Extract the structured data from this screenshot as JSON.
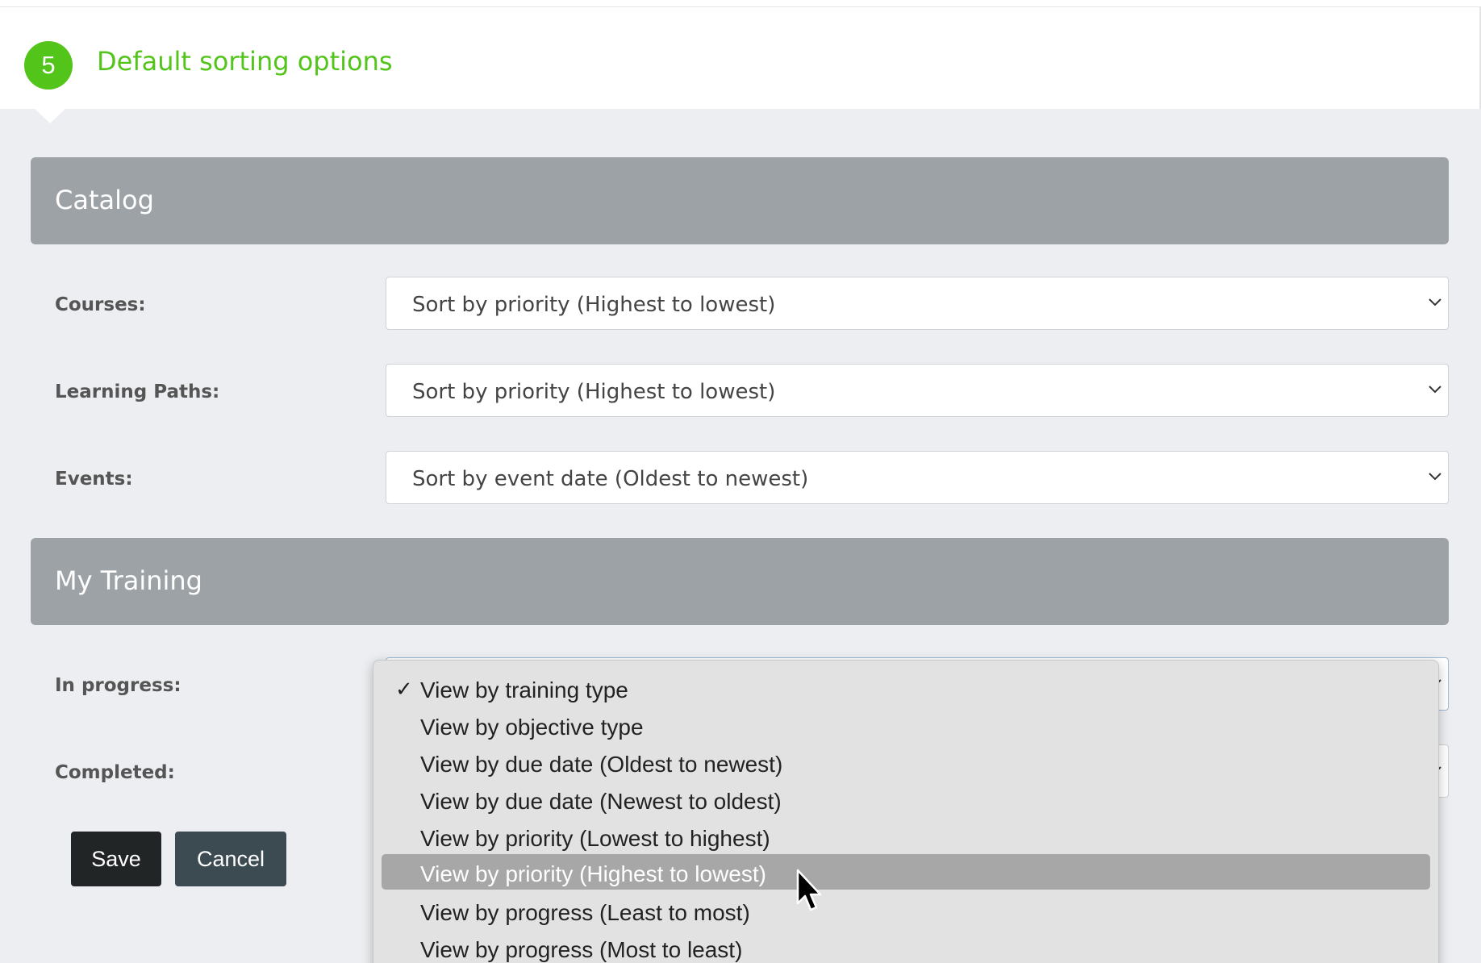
{
  "step": {
    "number": "5",
    "title": "Default sorting options"
  },
  "catalog": {
    "heading": "Catalog",
    "fields": [
      {
        "label": "Courses:",
        "value": "Sort by priority (Highest to lowest)"
      },
      {
        "label": "Learning Paths:",
        "value": "Sort by priority (Highest to lowest)"
      },
      {
        "label": "Events:",
        "value": "Sort by event date (Oldest to newest)"
      }
    ]
  },
  "my_training": {
    "heading": "My Training",
    "fields": [
      {
        "label": "In progress:"
      },
      {
        "label": "Completed:"
      }
    ]
  },
  "buttons": {
    "save": "Save",
    "cancel": "Cancel"
  },
  "dropdown": {
    "checkmark": "✓",
    "selected_index": 0,
    "highlighted_index": 5,
    "options": [
      "View by training type",
      "View by objective type",
      "View by due date (Oldest to newest)",
      "View by due date (Newest to oldest)",
      "View by priority (Lowest to highest)",
      "View by priority (Highest to lowest)",
      "View by progress (Least to most)",
      "View by progress (Most to least)"
    ]
  },
  "colors": {
    "accent_green": "#52c41a",
    "section_bar": "#9da2a6",
    "save_button": "#222526",
    "cancel_button": "#3c4b52",
    "highlight": "#a7a7a7"
  }
}
